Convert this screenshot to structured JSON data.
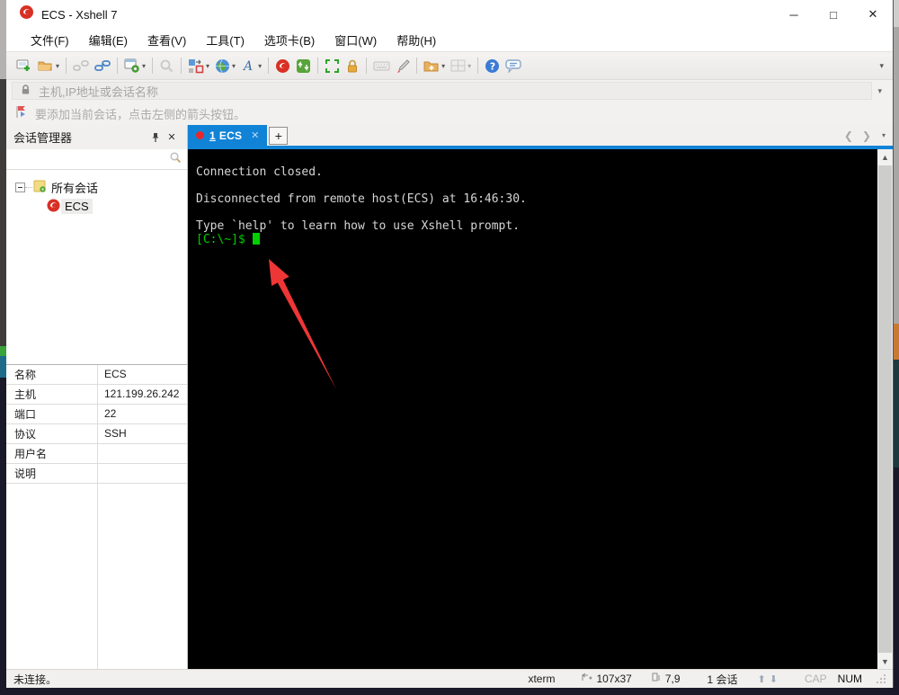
{
  "window": {
    "title": "ECS - Xshell 7",
    "minimize": "─",
    "maximize": "□",
    "close": "✕"
  },
  "menu": {
    "items": [
      {
        "label": "文件(F)"
      },
      {
        "label": "编辑(E)"
      },
      {
        "label": "查看(V)"
      },
      {
        "label": "工具(T)"
      },
      {
        "label": "选项卡(B)"
      },
      {
        "label": "窗口(W)"
      },
      {
        "label": "帮助(H)"
      }
    ]
  },
  "toolbar": {
    "icons": [
      "new-session-icon",
      "open-folder-icon",
      "disconnect-icon",
      "reconnect-icon",
      "session-properties-icon",
      "find-icon",
      "compose-icon",
      "globe-icon",
      "font-icon",
      "xshell-icon",
      "xftp-icon",
      "fullscreen-icon",
      "lock-icon",
      "keyboard-icon",
      "highlighter-icon",
      "new-folder-icon",
      "tile-layout-icon",
      "help-icon",
      "message-icon"
    ]
  },
  "address_bar": {
    "placeholder": "主机,IP地址或会话名称"
  },
  "info_bar": {
    "text": "要添加当前会话，点击左侧的箭头按钮。"
  },
  "session_manager": {
    "title": "会话管理器",
    "tree": {
      "root_label": "所有会话",
      "child_label": "ECS"
    }
  },
  "tabs": {
    "active_number": "1",
    "active_label": "ECS",
    "close": "✕",
    "new_tab": "+"
  },
  "terminal": {
    "lines": [
      "Connection closed.",
      "",
      "Disconnected from remote host(ECS) at 16:46:30.",
      "",
      "Type `help' to learn how to use Xshell prompt."
    ],
    "prompt": "[C:\\~]$"
  },
  "properties": {
    "rows": [
      {
        "label": "名称",
        "value": "ECS"
      },
      {
        "label": "主机",
        "value": "121.199.26.242"
      },
      {
        "label": "端口",
        "value": "22"
      },
      {
        "label": "协议",
        "value": "SSH"
      },
      {
        "label": "用户名",
        "value": ""
      },
      {
        "label": "说明",
        "value": ""
      }
    ]
  },
  "status_bar": {
    "connection": "未连接。",
    "term_type": "xterm",
    "screen_size": "107x37",
    "cursor_pos": "7,9",
    "sessions": "1 会话",
    "cap": "CAP",
    "num": "NUM"
  },
  "colors": {
    "tab_active": "#1183d6",
    "terminal_green": "#00cf00",
    "arrow_red": "#ee3636",
    "session_red": "#d93025"
  }
}
